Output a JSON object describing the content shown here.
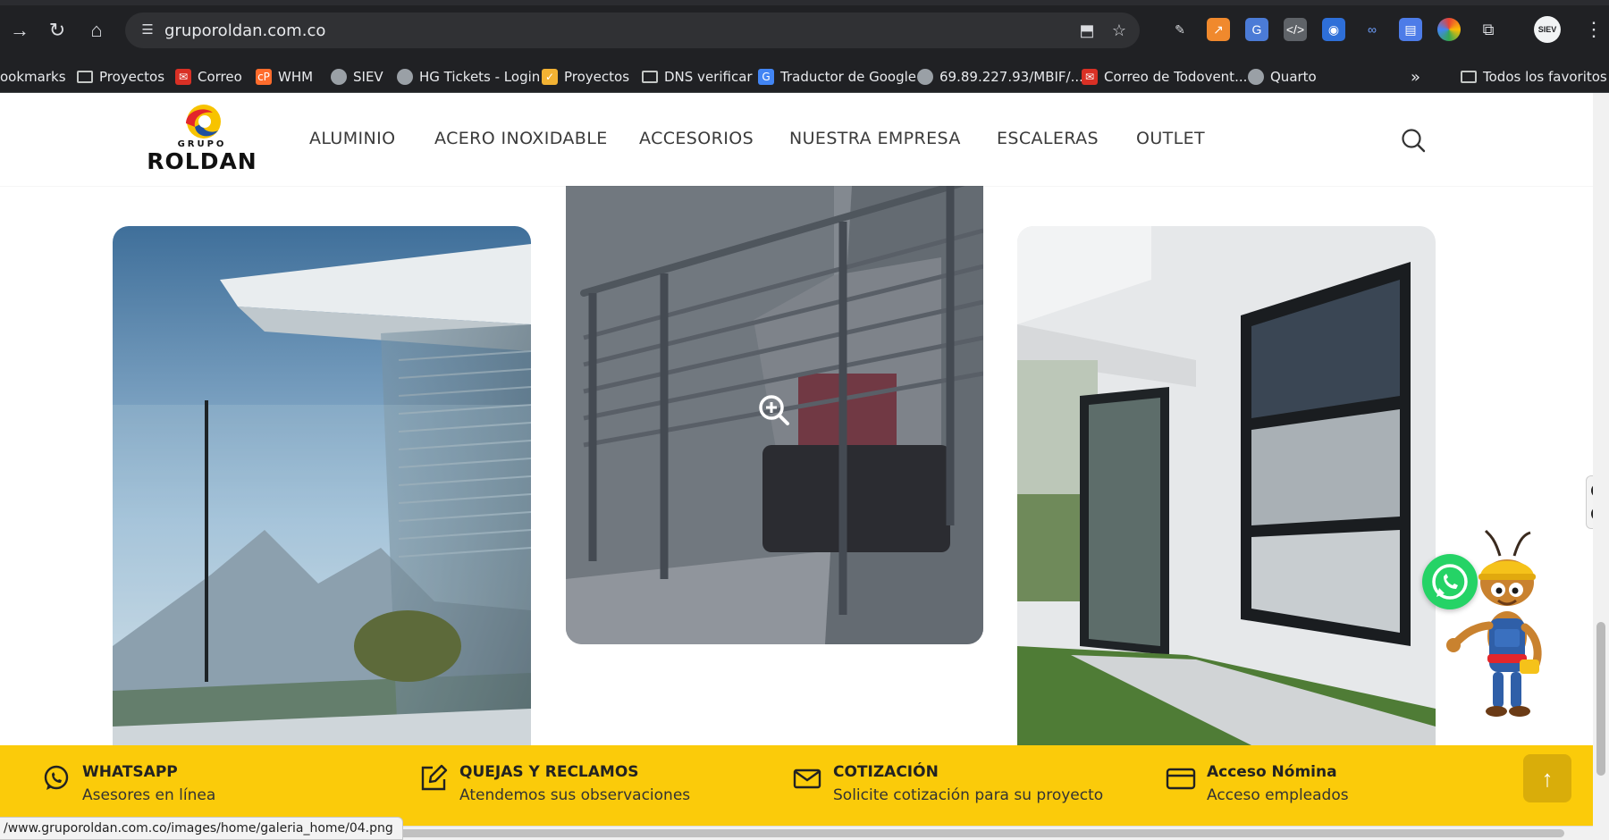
{
  "browser": {
    "url": "gruporoldan.com.co",
    "profile_badge": "SIEV"
  },
  "bookmarks": {
    "items": [
      {
        "label": "ookmarks",
        "icon": "none"
      },
      {
        "label": "Proyectos",
        "icon": "folder-icon"
      },
      {
        "label": "Correo",
        "icon": "mail-icon"
      },
      {
        "label": "WHM",
        "icon": "cpanel-icon"
      },
      {
        "label": "SIEV",
        "icon": "globe-icon"
      },
      {
        "label": "HG Tickets - Login",
        "icon": "globe-icon"
      },
      {
        "label": "Proyectos",
        "icon": "project-icon"
      },
      {
        "label": "DNS verificar",
        "icon": "folder-icon"
      },
      {
        "label": "Traductor de Google",
        "icon": "translate-icon"
      },
      {
        "label": "69.89.227.93/MBIF/...",
        "icon": "globe-icon"
      },
      {
        "label": "Correo de Todovent...",
        "icon": "mail-icon"
      },
      {
        "label": "Quarto",
        "icon": "globe-icon"
      }
    ],
    "overflow": "»",
    "all_favorites": "Todos los favoritos"
  },
  "site": {
    "logo": {
      "line1": "GRUPO",
      "line2": "ROLDAN"
    },
    "menu": [
      "ALUMINIO",
      "ACERO INOXIDABLE",
      "ACCESORIOS",
      "NUESTRA EMPRESA",
      "ESCALERAS",
      "OUTLET"
    ]
  },
  "footer": {
    "items": [
      {
        "title": "WHATSAPP",
        "subtitle": "Asesores en línea",
        "icon": "whatsapp-icon"
      },
      {
        "title": "QUEJAS Y RECLAMOS",
        "subtitle": "Atendemos sus observaciones",
        "icon": "edit-icon"
      },
      {
        "title": "COTIZACIÓN",
        "subtitle": "Solicite cotización para su proyecto",
        "icon": "mail-icon"
      },
      {
        "title": "Acceso Nómina",
        "subtitle": "Acceso empleados",
        "icon": "card-icon"
      }
    ],
    "back_to_top": "↑"
  },
  "status_bar": {
    "url": "/www.gruporoldan.com.co/images/home/galeria_home/04.png"
  },
  "colors": {
    "footer_bg": "#fbcb0a",
    "whatsapp_green": "#25d366",
    "logo_red": "#e3262b",
    "logo_blue": "#1d4fa0",
    "logo_yellow": "#f7c300",
    "browser_dark": "#202124"
  }
}
